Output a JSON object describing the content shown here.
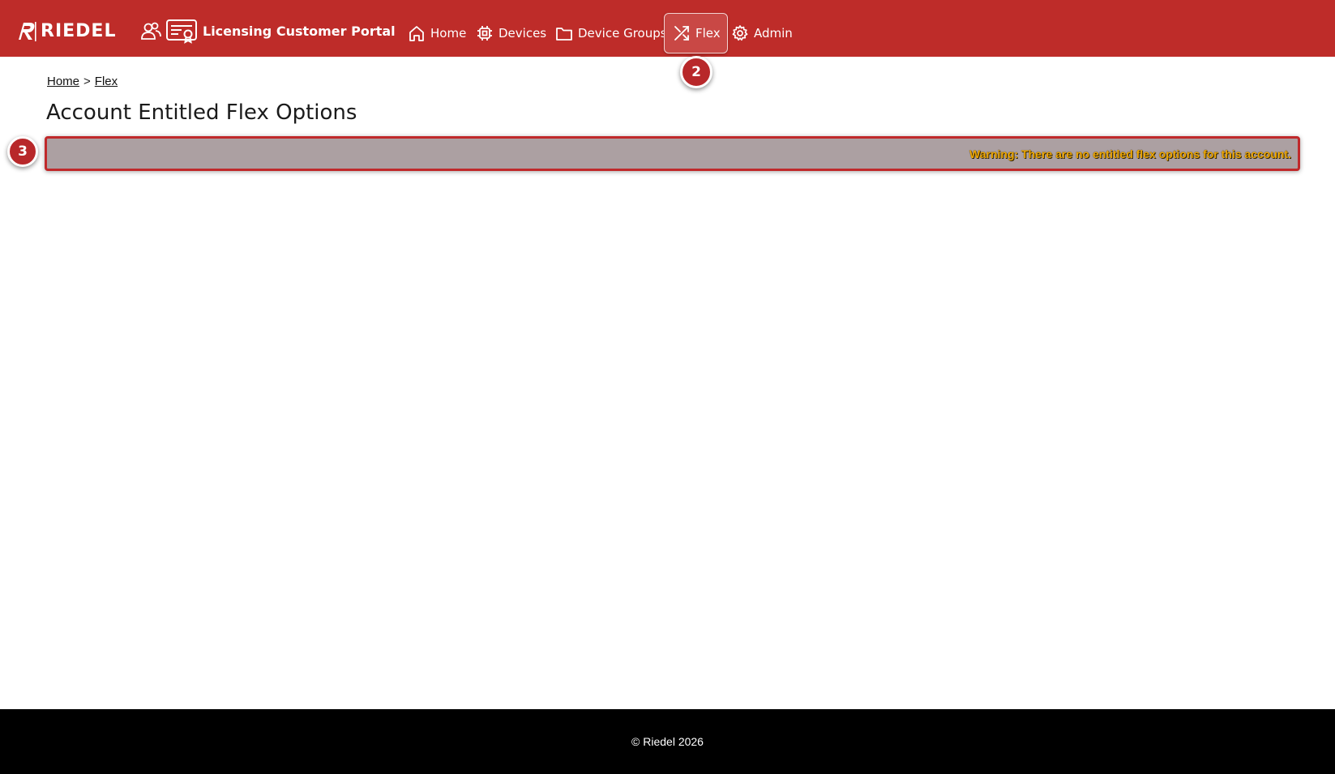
{
  "brand": {
    "logo_text": "RIEDEL",
    "portal_title": "Licensing Customer Portal"
  },
  "nav": {
    "home": "Home",
    "devices": "Devices",
    "device_groups": "Device Groups",
    "flex": "Flex",
    "admin": "Admin",
    "active": "Flex"
  },
  "badges": {
    "step2": "2",
    "step3": "3"
  },
  "breadcrumb": {
    "home": "Home",
    "separator": ">",
    "current": "Flex"
  },
  "page": {
    "title": "Account Entitled Flex Options",
    "warning": "Warning: There are no entitled flex options for this account."
  },
  "footer": {
    "copyright": "© Riedel 2026"
  },
  "colors": {
    "brand_red": "#be2c29",
    "warning_bg": "#aca0a2",
    "warning_text": "#f0a800",
    "footer_bg": "#000000"
  }
}
